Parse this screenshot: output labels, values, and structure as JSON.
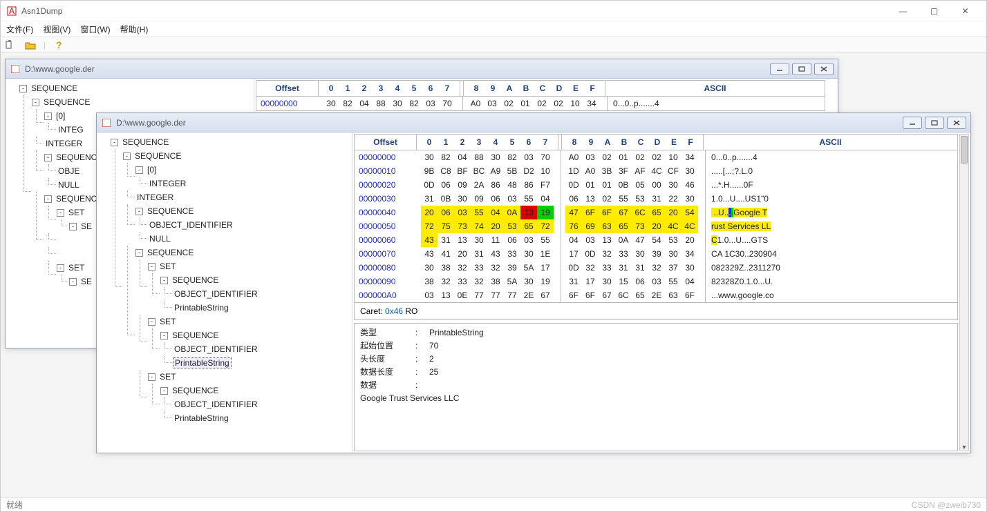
{
  "app": {
    "title": "Asn1Dump",
    "menus": [
      "文件(F)",
      "视图(V)",
      "窗口(W)",
      "帮助(H)"
    ],
    "status_left": "就绪",
    "status_right": "CSDN @zweib730"
  },
  "mdi1": {
    "title": "D:\\www.google.der",
    "tree": [
      "SEQUENCE",
      "SEQUENCE",
      "[0]",
      "INTEGER",
      "INTEGER",
      "SEQUENCE",
      "OBJECT_IDENTIFIER",
      "NULL",
      "SEQUENCE",
      "SET",
      "SEQUENCE"
    ],
    "hex_header_offset": "Offset",
    "hex_header_cols1": [
      "0",
      "1",
      "2",
      "3",
      "4",
      "5",
      "6",
      "7"
    ],
    "hex_header_cols2": [
      "8",
      "9",
      "A",
      "B",
      "C",
      "D",
      "E",
      "F"
    ],
    "hex_header_asc": "ASCII",
    "row0_off": "00000000",
    "row0a": [
      "30",
      "82",
      "04",
      "88",
      "30",
      "82",
      "03",
      "70"
    ],
    "row0b": [
      "A0",
      "03",
      "02",
      "01",
      "02",
      "02",
      "10",
      "34"
    ],
    "row0_asc": "0...0..p.......4"
  },
  "mdi2": {
    "title": "D:\\www.google.der",
    "tree_lines": [
      {
        "depth": 0,
        "toggle": "-",
        "label": "SEQUENCE"
      },
      {
        "depth": 1,
        "toggle": "-",
        "label": "SEQUENCE"
      },
      {
        "depth": 2,
        "toggle": "-",
        "label": "[0]"
      },
      {
        "depth": 3,
        "toggle": "",
        "label": "INTEGER"
      },
      {
        "depth": 2,
        "toggle": "",
        "label": "INTEGER"
      },
      {
        "depth": 2,
        "toggle": "-",
        "label": "SEQUENCE"
      },
      {
        "depth": 3,
        "toggle": "",
        "label": "OBJECT_IDENTIFIER"
      },
      {
        "depth": 3,
        "toggle": "",
        "label": "NULL"
      },
      {
        "depth": 2,
        "toggle": "-",
        "label": "SEQUENCE"
      },
      {
        "depth": 3,
        "toggle": "-",
        "label": "SET"
      },
      {
        "depth": 4,
        "toggle": "-",
        "label": "SEQUENCE"
      },
      {
        "depth": 5,
        "toggle": "",
        "label": "OBJECT_IDENTIFIER"
      },
      {
        "depth": 5,
        "toggle": "",
        "label": "PrintableString"
      },
      {
        "depth": 3,
        "toggle": "-",
        "label": "SET"
      },
      {
        "depth": 4,
        "toggle": "-",
        "label": "SEQUENCE"
      },
      {
        "depth": 5,
        "toggle": "",
        "label": "OBJECT_IDENTIFIER"
      },
      {
        "depth": 5,
        "toggle": "",
        "label": "PrintableString",
        "selected": true
      },
      {
        "depth": 3,
        "toggle": "-",
        "label": "SET"
      },
      {
        "depth": 4,
        "toggle": "-",
        "label": "SEQUENCE"
      },
      {
        "depth": 5,
        "toggle": "",
        "label": "OBJECT_IDENTIFIER"
      },
      {
        "depth": 5,
        "toggle": "",
        "label": "PrintableString"
      }
    ],
    "hex_header_offset": "Offset",
    "hex_header_cols1": [
      "0",
      "1",
      "2",
      "3",
      "4",
      "5",
      "6",
      "7"
    ],
    "hex_header_cols2": [
      "8",
      "9",
      "A",
      "B",
      "C",
      "D",
      "E",
      "F"
    ],
    "hex_header_asc": "ASCII",
    "rows": [
      {
        "off": "00000000",
        "a": [
          "30",
          "82",
          "04",
          "88",
          "30",
          "82",
          "03",
          "70"
        ],
        "b": [
          "A0",
          "03",
          "02",
          "01",
          "02",
          "02",
          "10",
          "34"
        ],
        "asc": "0...0..p.......4"
      },
      {
        "off": "00000010",
        "a": [
          "9B",
          "C8",
          "BF",
          "BC",
          "A9",
          "5B",
          "D2",
          "10"
        ],
        "b": [
          "1D",
          "A0",
          "3B",
          "3F",
          "AF",
          "4C",
          "CF",
          "30"
        ],
        "asc": ".....[...;?.L.0"
      },
      {
        "off": "00000020",
        "a": [
          "0D",
          "06",
          "09",
          "2A",
          "86",
          "48",
          "86",
          "F7"
        ],
        "b": [
          "0D",
          "01",
          "01",
          "0B",
          "05",
          "00",
          "30",
          "46"
        ],
        "asc": "...*.H......0F"
      },
      {
        "off": "00000030",
        "a": [
          "31",
          "0B",
          "30",
          "09",
          "06",
          "03",
          "55",
          "04"
        ],
        "b": [
          "06",
          "13",
          "02",
          "55",
          "53",
          "31",
          "22",
          "30"
        ],
        "asc": "1.0...U....US1\"0"
      },
      {
        "off": "00000040",
        "a": [
          "20",
          "06",
          "03",
          "55",
          "04",
          "0A",
          "13",
          "19"
        ],
        "b": [
          "47",
          "6F",
          "6F",
          "67",
          "6C",
          "65",
          "20",
          "54"
        ],
        "asc": " ..U....Google T",
        "hlA": {
          "6": "red",
          "7": "green"
        },
        "hlWrapA": "yellow",
        "hlB": {
          "0": "yellow",
          "1": "yellow",
          "2": "yellow",
          "3": "yellow",
          "4": "yellow",
          "5": "yellow",
          "6": "yellow",
          "7": "yellow"
        },
        "ascHL": {
          "6": "blue",
          "7": "green",
          "range": "yellow"
        }
      },
      {
        "off": "00000050",
        "a": [
          "72",
          "75",
          "73",
          "74",
          "20",
          "53",
          "65",
          "72"
        ],
        "b": [
          "76",
          "69",
          "63",
          "65",
          "73",
          "20",
          "4C",
          "4C"
        ],
        "asc": "rust Services LL",
        "hlWrapA": "yellow",
        "hlB": {
          "0": "yellow",
          "1": "yellow",
          "2": "yellow",
          "3": "yellow",
          "4": "yellow",
          "5": "yellow",
          "6": "yellow",
          "7": "yellow"
        },
        "ascHL": {
          "range": "yellow"
        }
      },
      {
        "off": "00000060",
        "a": [
          "43",
          "31",
          "13",
          "30",
          "11",
          "06",
          "03",
          "55"
        ],
        "b": [
          "04",
          "03",
          "13",
          "0A",
          "47",
          "54",
          "53",
          "20"
        ],
        "asc": "C1.0...U....GTS ",
        "hlA": {
          "0": "yellow"
        },
        "ascHL": {
          "0": "yellow"
        }
      },
      {
        "off": "00000070",
        "a": [
          "43",
          "41",
          "20",
          "31",
          "43",
          "33",
          "30",
          "1E"
        ],
        "b": [
          "17",
          "0D",
          "32",
          "33",
          "30",
          "39",
          "30",
          "34"
        ],
        "asc": "CA 1C30..230904"
      },
      {
        "off": "00000080",
        "a": [
          "30",
          "38",
          "32",
          "33",
          "32",
          "39",
          "5A",
          "17"
        ],
        "b": [
          "0D",
          "32",
          "33",
          "31",
          "31",
          "32",
          "37",
          "30"
        ],
        "asc": "082329Z..2311270"
      },
      {
        "off": "00000090",
        "a": [
          "38",
          "32",
          "33",
          "32",
          "38",
          "5A",
          "30",
          "19"
        ],
        "b": [
          "31",
          "17",
          "30",
          "15",
          "06",
          "03",
          "55",
          "04"
        ],
        "asc": "82328Z0.1.0...U."
      },
      {
        "off": "000000A0",
        "a": [
          "03",
          "13",
          "0E",
          "77",
          "77",
          "77",
          "2E",
          "67"
        ],
        "b": [
          "6F",
          "6F",
          "67",
          "6C",
          "65",
          "2E",
          "63",
          "6F"
        ],
        "asc": "...www.google.co"
      }
    ],
    "caret_label": "Caret: ",
    "caret_value": "0x46",
    "caret_suffix": " RO",
    "detail": {
      "type_lbl": "类型",
      "type_val": "PrintableString",
      "start_lbl": "起始位置",
      "start_val": "70",
      "hlen_lbl": "头长度",
      "hlen_val": "2",
      "dlen_lbl": "数据长度",
      "dlen_val": "25",
      "data_lbl": "数据",
      "data_val": "",
      "data_text": "Google Trust Services LLC"
    }
  },
  "back_tree": [
    {
      "depth": 0,
      "toggle": "-",
      "label": "SEQUENCE"
    },
    {
      "depth": 1,
      "toggle": "-",
      "label": "SEQUENCE"
    },
    {
      "depth": 2,
      "toggle": "-",
      "label": "[0]"
    },
    {
      "depth": 3,
      "toggle": "",
      "label": "INTEG"
    },
    {
      "depth": 2,
      "toggle": "",
      "label": "INTEGER"
    },
    {
      "depth": 2,
      "toggle": "-",
      "label": "SEQUENC"
    },
    {
      "depth": 3,
      "toggle": "",
      "label": "OBJE"
    },
    {
      "depth": 3,
      "toggle": "",
      "label": "NULL"
    },
    {
      "depth": 2,
      "toggle": "-",
      "label": "SEQUENC"
    },
    {
      "depth": 3,
      "toggle": "-",
      "label": "SET"
    },
    {
      "depth": 4,
      "toggle": "-",
      "label": "SE"
    },
    {
      "depth": 3,
      "toggle": "",
      "label": ""
    },
    {
      "depth": 3,
      "toggle": "",
      "label": ""
    },
    {
      "depth": 3,
      "toggle": "-",
      "label": "SET"
    },
    {
      "depth": 4,
      "toggle": "-",
      "label": "SE"
    }
  ]
}
